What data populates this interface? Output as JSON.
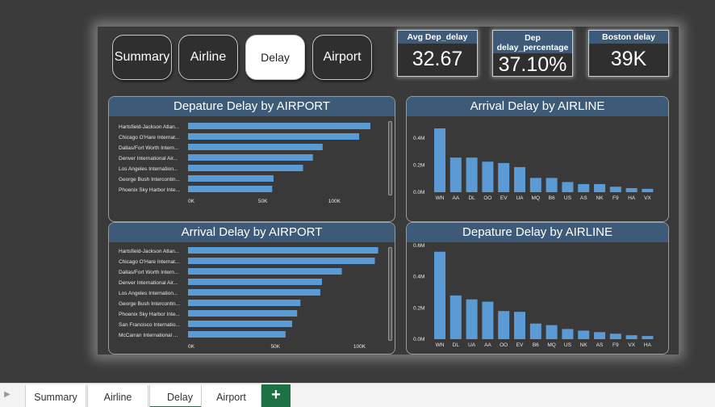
{
  "nav": {
    "buttons": [
      {
        "label": "Summary",
        "active": false
      },
      {
        "label": "Airline",
        "active": false
      },
      {
        "label": "Delay",
        "active": true
      },
      {
        "label": "Airport",
        "active": false
      }
    ]
  },
  "kpis": [
    {
      "title": "Avg Dep_delay",
      "value": "32.67"
    },
    {
      "title": "Dep delay_percentage",
      "value": "37.10%"
    },
    {
      "title": "Boston delay",
      "value": "39K"
    }
  ],
  "colors": {
    "bar": "#5b9bd5",
    "header": "#3d5b78",
    "accent_green": "#1e7145"
  },
  "chart_data": [
    {
      "type": "bar",
      "orientation": "horizontal",
      "title": "Depature Delay by AIRPORT",
      "categories": [
        "Hartsfield-Jackson Atlan...",
        "Chicago O'Hare Internat...",
        "Dallas/Fort Worth Intern...",
        "Denver International Air...",
        "Los Angeles Internation...",
        "George Bush Intercontin...",
        "Phoenix Sky Harbor Inte..."
      ],
      "values": [
        130000,
        122000,
        96000,
        89000,
        82000,
        61000,
        60000
      ],
      "xlim": [
        0,
        145000
      ],
      "ticks": [
        {
          "value": 0,
          "label": "0K"
        },
        {
          "value": 50000,
          "label": "50K"
        },
        {
          "value": 100000,
          "label": "100K"
        }
      ]
    },
    {
      "type": "bar",
      "orientation": "vertical",
      "title": "Arrival Delay by AIRLINE",
      "categories": [
        "WN",
        "AA",
        "DL",
        "OO",
        "EV",
        "UA",
        "MQ",
        "B6",
        "US",
        "AS",
        "NK",
        "F9",
        "HA",
        "VX"
      ],
      "values": [
        470000,
        255000,
        255000,
        225000,
        215000,
        185000,
        105000,
        105000,
        75000,
        60000,
        60000,
        40000,
        30000,
        25000
      ],
      "ylim": [
        0,
        500000
      ],
      "ticks": [
        {
          "value": 0,
          "label": "0.0M"
        },
        {
          "value": 200000,
          "label": "0.2M"
        },
        {
          "value": 400000,
          "label": "0.4M"
        }
      ]
    },
    {
      "type": "bar",
      "orientation": "horizontal",
      "title": "Arrival Delay by AIRPORT",
      "categories": [
        "Hartsfield-Jackson Atlan...",
        "Chicago O'Hare Internat...",
        "Dallas/Fort Worth Intern...",
        "Denver International Air...",
        "Los Angeles Internation...",
        "George Bush Intercontin...",
        "Phoenix Sky Harbor Inte...",
        "San Francisco Internatio...",
        "McCarran International ..."
      ],
      "values": [
        115000,
        113000,
        93000,
        81000,
        80000,
        68000,
        66000,
        63000,
        59000
      ],
      "xlim": [
        0,
        123000
      ],
      "ticks": [
        {
          "value": 0,
          "label": "0K"
        },
        {
          "value": 50000,
          "label": "50K"
        },
        {
          "value": 100000,
          "label": "100K"
        }
      ]
    },
    {
      "type": "bar",
      "orientation": "vertical",
      "title": "Depature Delay by AIRLINE",
      "categories": [
        "WN",
        "DL",
        "UA",
        "AA",
        "OO",
        "EV",
        "B6",
        "MQ",
        "US",
        "NK",
        "AS",
        "F9",
        "VX",
        "HA"
      ],
      "values": [
        560000,
        280000,
        255000,
        240000,
        180000,
        175000,
        100000,
        90000,
        65000,
        55000,
        45000,
        35000,
        25000,
        20000
      ],
      "ylim": [
        0,
        600000
      ],
      "ticks": [
        {
          "value": 0,
          "label": "0.0M"
        },
        {
          "value": 200000,
          "label": "0.2M"
        },
        {
          "value": 400000,
          "label": "0.4M"
        },
        {
          "value": 600000,
          "label": "0.6M"
        }
      ]
    }
  ],
  "tabs": [
    {
      "label": "Summary",
      "active": false
    },
    {
      "label": "Airline",
      "active": false
    },
    {
      "label": "Delay",
      "active": true
    },
    {
      "label": "Airport",
      "active": false
    }
  ],
  "add_sheet_label": "+",
  "tab_scroll_icon": "chevron-right-icon"
}
